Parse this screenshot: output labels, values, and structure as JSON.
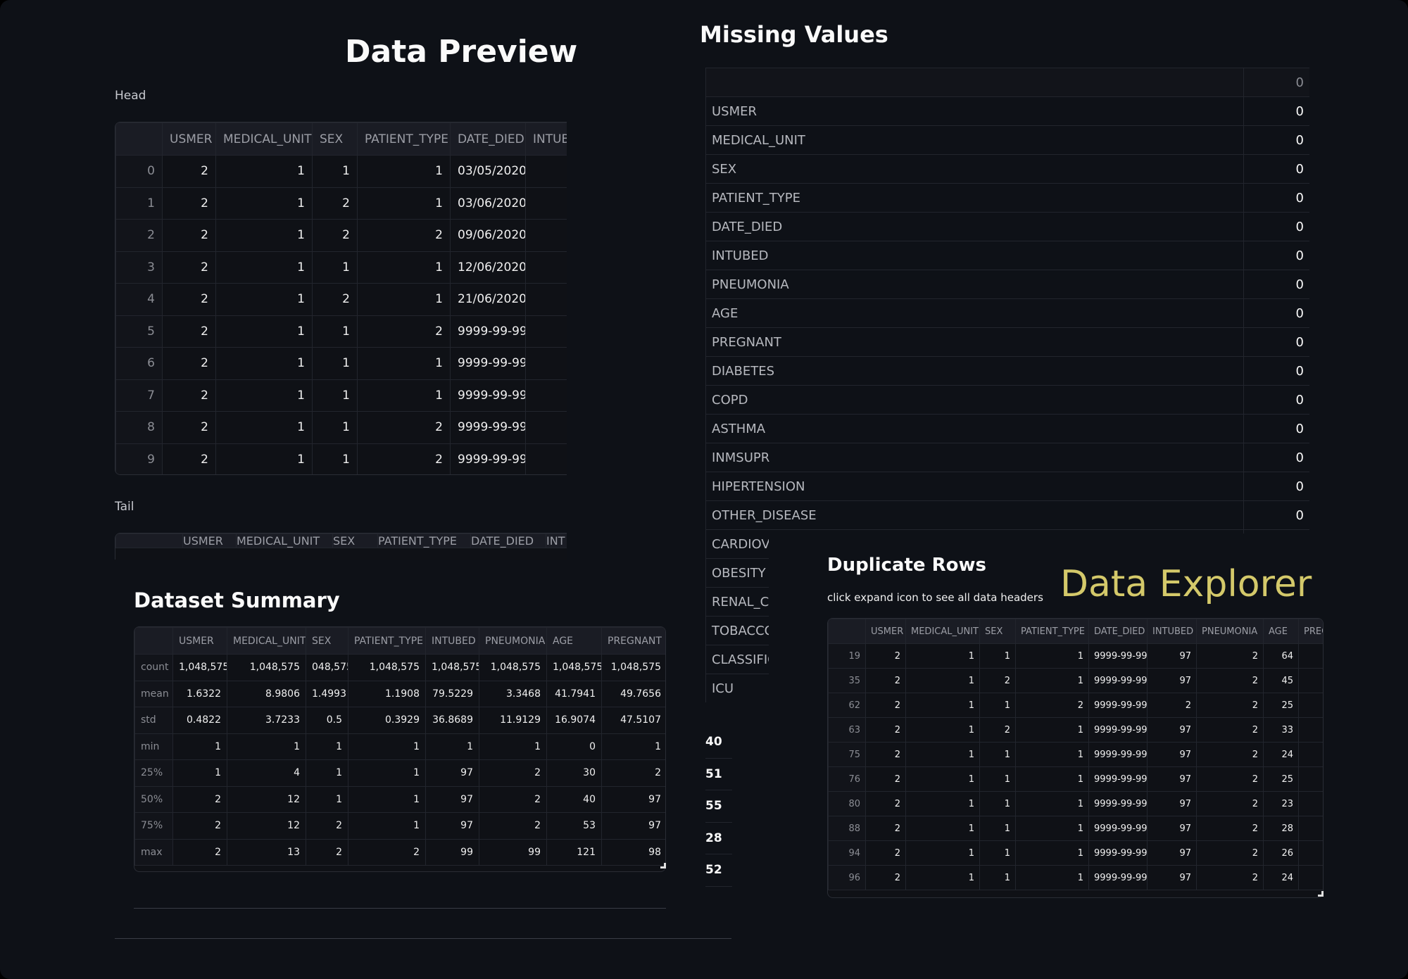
{
  "data_preview": {
    "title": "Data Preview",
    "head_label": "Head",
    "tail_label": "Tail",
    "head_columns": [
      "",
      "USMER",
      "MEDICAL_UNIT",
      "SEX",
      "PATIENT_TYPE",
      "DATE_DIED",
      "INTUB"
    ],
    "head_rows": [
      [
        "0",
        "2",
        "1",
        "1",
        "1",
        "03/05/2020",
        ""
      ],
      [
        "1",
        "2",
        "1",
        "2",
        "1",
        "03/06/2020",
        ""
      ],
      [
        "2",
        "2",
        "1",
        "2",
        "2",
        "09/06/2020",
        ""
      ],
      [
        "3",
        "2",
        "1",
        "1",
        "1",
        "12/06/2020",
        ""
      ],
      [
        "4",
        "2",
        "1",
        "2",
        "1",
        "21/06/2020",
        ""
      ],
      [
        "5",
        "2",
        "1",
        "1",
        "2",
        "9999-99-99",
        ""
      ],
      [
        "6",
        "2",
        "1",
        "1",
        "1",
        "9999-99-99",
        ""
      ],
      [
        "7",
        "2",
        "1",
        "1",
        "1",
        "9999-99-99",
        ""
      ],
      [
        "8",
        "2",
        "1",
        "1",
        "2",
        "9999-99-99",
        ""
      ],
      [
        "9",
        "2",
        "1",
        "1",
        "2",
        "9999-99-99",
        ""
      ]
    ],
    "tail_columns": [
      "",
      "USMER",
      "MEDICAL_UNIT",
      "SEX",
      "PATIENT_TYPE",
      "DATE_DIED",
      "INT"
    ]
  },
  "missing_values": {
    "title": "Missing Values",
    "header_value": "0",
    "rows": [
      [
        "USMER",
        "0"
      ],
      [
        "MEDICAL_UNIT",
        "0"
      ],
      [
        "SEX",
        "0"
      ],
      [
        "PATIENT_TYPE",
        "0"
      ],
      [
        "DATE_DIED",
        "0"
      ],
      [
        "INTUBED",
        "0"
      ],
      [
        "PNEUMONIA",
        "0"
      ],
      [
        "AGE",
        "0"
      ],
      [
        "PREGNANT",
        "0"
      ],
      [
        "DIABETES",
        "0"
      ],
      [
        "COPD",
        "0"
      ],
      [
        "ASTHMA",
        "0"
      ],
      [
        "INMSUPR",
        "0"
      ],
      [
        "HIPERTENSION",
        "0"
      ],
      [
        "OTHER_DISEASE",
        "0"
      ],
      [
        "CARDIOVA",
        ""
      ],
      [
        "OBESITY",
        ""
      ],
      [
        "RENAL_CH",
        ""
      ],
      [
        "TOBACCO",
        ""
      ],
      [
        "CLASSIFIC",
        ""
      ],
      [
        "ICU",
        ""
      ]
    ]
  },
  "behind_values": [
    "40",
    "51",
    "55",
    "28",
    "52"
  ],
  "summary": {
    "title": "Dataset Summary",
    "columns": [
      "",
      "USMER",
      "MEDICAL_UNIT",
      "SEX",
      "PATIENT_TYPE",
      "INTUBED",
      "PNEUMONIA",
      "AGE",
      "PREGNANT"
    ],
    "rows": [
      [
        "count",
        "1,048,575",
        "1,048,575",
        "048,575",
        "1,048,575",
        "1,048,575",
        "1,048,575",
        "1,048,575",
        "1,048,575"
      ],
      [
        "mean",
        "1.6322",
        "8.9806",
        "1.4993",
        "1.1908",
        "79.5229",
        "3.3468",
        "41.7941",
        "49.7656"
      ],
      [
        "std",
        "0.4822",
        "3.7233",
        "0.5",
        "0.3929",
        "36.8689",
        "11.9129",
        "16.9074",
        "47.5107"
      ],
      [
        "min",
        "1",
        "1",
        "1",
        "1",
        "1",
        "1",
        "0",
        "1"
      ],
      [
        "25%",
        "1",
        "4",
        "1",
        "1",
        "97",
        "2",
        "30",
        "2"
      ],
      [
        "50%",
        "2",
        "12",
        "1",
        "1",
        "97",
        "2",
        "40",
        "97"
      ],
      [
        "75%",
        "2",
        "12",
        "2",
        "1",
        "97",
        "2",
        "53",
        "97"
      ],
      [
        "max",
        "2",
        "13",
        "2",
        "2",
        "99",
        "99",
        "121",
        "98"
      ]
    ]
  },
  "duplicates": {
    "title": "Duplicate Rows",
    "caption": "click expand icon to see all data headers",
    "columns": [
      "",
      "USMER",
      "MEDICAL_UNIT",
      "SEX",
      "PATIENT_TYPE",
      "DATE_DIED",
      "INTUBED",
      "PNEUMONIA",
      "AGE",
      "PREG"
    ],
    "rows": [
      [
        "19",
        "2",
        "1",
        "1",
        "1",
        "9999-99-99",
        "97",
        "2",
        "64",
        ""
      ],
      [
        "35",
        "2",
        "1",
        "2",
        "1",
        "9999-99-99",
        "97",
        "2",
        "45",
        ""
      ],
      [
        "62",
        "2",
        "1",
        "1",
        "2",
        "9999-99-99",
        "2",
        "2",
        "25",
        ""
      ],
      [
        "63",
        "2",
        "1",
        "2",
        "1",
        "9999-99-99",
        "97",
        "2",
        "33",
        ""
      ],
      [
        "75",
        "2",
        "1",
        "1",
        "1",
        "9999-99-99",
        "97",
        "2",
        "24",
        ""
      ],
      [
        "76",
        "2",
        "1",
        "1",
        "1",
        "9999-99-99",
        "97",
        "2",
        "25",
        ""
      ],
      [
        "80",
        "2",
        "1",
        "1",
        "1",
        "9999-99-99",
        "97",
        "2",
        "23",
        ""
      ],
      [
        "88",
        "2",
        "1",
        "1",
        "1",
        "9999-99-99",
        "97",
        "2",
        "28",
        ""
      ],
      [
        "94",
        "2",
        "1",
        "1",
        "1",
        "9999-99-99",
        "97",
        "2",
        "26",
        ""
      ],
      [
        "96",
        "2",
        "1",
        "1",
        "1",
        "9999-99-99",
        "97",
        "2",
        "24",
        ""
      ]
    ]
  },
  "data_explorer": {
    "title": "Data Explorer",
    "color": "#d4c96a"
  }
}
